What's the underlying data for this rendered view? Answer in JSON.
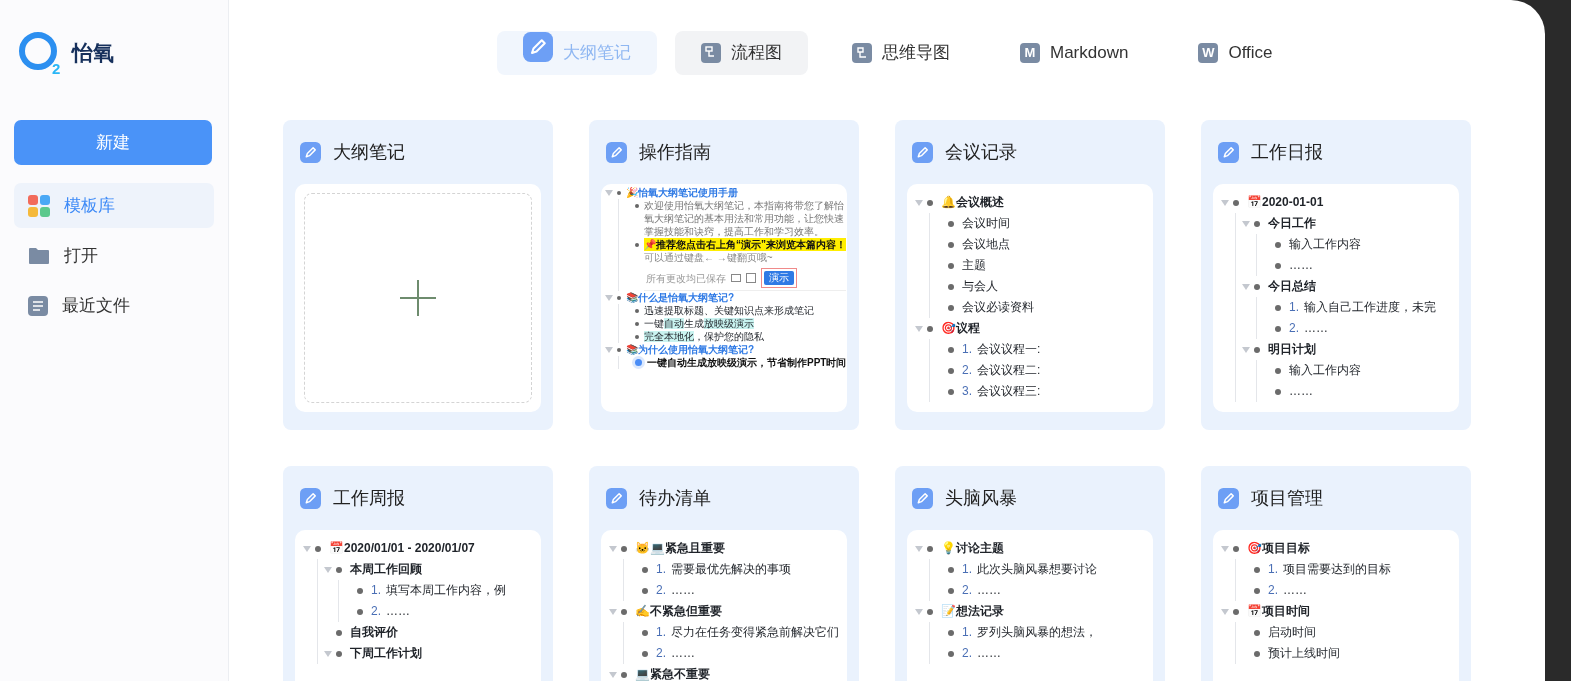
{
  "app": {
    "name": "怡氧",
    "logo_mark": "2"
  },
  "sidebar": {
    "new_button": "新建",
    "items": [
      {
        "label": "模板库",
        "kind": "grid",
        "selected": true
      },
      {
        "label": "打开",
        "kind": "folder",
        "selected": false
      },
      {
        "label": "最近文件",
        "kind": "doc",
        "selected": false
      }
    ]
  },
  "tabs": [
    {
      "label": "大纲笔记",
      "kind": "pen",
      "selected": true,
      "hovered": false
    },
    {
      "label": "流程图",
      "kind": "flow",
      "selected": false,
      "hovered": true
    },
    {
      "label": "思维导图",
      "kind": "mind",
      "selected": false,
      "hovered": false
    },
    {
      "label": "Markdown",
      "kind": "letter",
      "badge": "M",
      "selected": false,
      "hovered": false
    },
    {
      "label": "Office",
      "kind": "letter",
      "badge": "W",
      "selected": false,
      "hovered": false
    }
  ],
  "cards": [
    {
      "title": "大纲笔记",
      "kind": "blank"
    },
    {
      "title": "操作指南",
      "kind": "guide",
      "items": [
        {
          "kind": "heading",
          "text": "🎉怡氧大纲笔记使用手册",
          "expanded": true,
          "children": [
            {
              "kind": "muted",
              "text": "欢迎使用怡氧大纲笔记，本指南将带您了解怡氧大纲笔记的基本用法和常用功能，让您快速掌握技能和诀窍，提高工作和学习效率。"
            },
            {
              "kind": "mark",
              "text": "📌推荐您点击右上角“演示”来浏览本篇内容！",
              "note": "可以通过键盘← →键翻页哦~",
              "toolbar": {
                "status": "所有更改均已保存",
                "button": "演示"
              }
            }
          ]
        },
        {
          "kind": "heading",
          "text": "📚什么是怡氧大纲笔记?",
          "expanded": true,
          "children": [
            {
              "kind": "plain",
              "text": "迅速提取标题、关键知识点来形成笔记"
            },
            {
              "kind": "plain",
              "segments": [
                {
                  "text": "一键",
                  "highlight": false
                },
                {
                  "text": "自动",
                  "highlight": true
                },
                {
                  "text": "生成",
                  "highlight": false
                },
                {
                  "text": "放映级演示",
                  "highlight": true
                }
              ]
            },
            {
              "kind": "plain",
              "segments": [
                {
                  "text": "完全本地化",
                  "highlight": true
                },
                {
                  "text": "，保护您的隐私",
                  "highlight": false
                }
              ]
            }
          ]
        },
        {
          "kind": "heading",
          "text": "📚为什么使用怡氧大纲笔记?",
          "expanded": true,
          "children": [
            {
              "kind": "strong",
              "text": "一键自动生成放映级演示，节省制作PPT时间",
              "active": true
            }
          ]
        }
      ]
    },
    {
      "title": "会议记录",
      "kind": "outline",
      "items": [
        {
          "text": "🔔会议概述",
          "bold": true,
          "expanded": true,
          "children": [
            {
              "text": "会议时间"
            },
            {
              "text": "会议地点"
            },
            {
              "text": "主题"
            },
            {
              "text": "与会人"
            },
            {
              "text": "会议必读资料"
            }
          ]
        },
        {
          "text": "🎯议程",
          "bold": true,
          "expanded": true,
          "children": [
            {
              "num": "1.",
              "text": "会议议程一:"
            },
            {
              "num": "2.",
              "text": "会议议程二:"
            },
            {
              "num": "3.",
              "text": "会议议程三:"
            }
          ]
        }
      ]
    },
    {
      "title": "工作日报",
      "kind": "outline",
      "items": [
        {
          "text": "📅2020-01-01",
          "bold": true,
          "expanded": true,
          "children": [
            {
              "text": "今日工作",
              "bold": true,
              "expanded": true,
              "children": [
                {
                  "text": "输入工作内容"
                },
                {
                  "text": "……"
                }
              ]
            },
            {
              "text": "今日总结",
              "bold": true,
              "expanded": true,
              "children": [
                {
                  "num": "1.",
                  "text": "输入自己工作进度，未完"
                },
                {
                  "num": "2.",
                  "text": "……"
                }
              ]
            },
            {
              "text": "明日计划",
              "bold": true,
              "expanded": true,
              "children": [
                {
                  "text": "输入工作内容"
                },
                {
                  "text": "……"
                }
              ]
            }
          ]
        }
      ]
    },
    {
      "title": "工作周报",
      "kind": "outline",
      "items": [
        {
          "text": "📅2020/01/01 - 2020/01/07",
          "bold": true,
          "expanded": true,
          "children": [
            {
              "text": "本周工作回顾",
              "bold": true,
              "expanded": true,
              "children": [
                {
                  "num": "1.",
                  "text": "填写本周工作内容，例"
                },
                {
                  "num": "2.",
                  "text": "……"
                }
              ]
            },
            {
              "text": "自我评价",
              "bold": true
            },
            {
              "text": "下周工作计划",
              "bold": true,
              "expanded": true
            }
          ]
        }
      ]
    },
    {
      "title": "待办清单",
      "kind": "outline",
      "items": [
        {
          "text": "🐱💻紧急且重要",
          "bold": true,
          "expanded": true,
          "children": [
            {
              "num": "1.",
              "text": "需要最优先解决的事项"
            },
            {
              "num": "2.",
              "text": "……"
            }
          ]
        },
        {
          "text": "✍不紧急但重要",
          "bold": true,
          "expanded": true,
          "children": [
            {
              "num": "1.",
              "text": "尽力在任务变得紧急前解决它们"
            },
            {
              "num": "2.",
              "text": "……"
            }
          ]
        },
        {
          "text": "💻紧急不重要",
          "bold": true,
          "expanded": true
        }
      ]
    },
    {
      "title": "头脑风暴",
      "kind": "outline",
      "items": [
        {
          "text": "💡讨论主题",
          "bold": true,
          "expanded": true,
          "children": [
            {
              "num": "1.",
              "text": "此次头脑风暴想要讨论"
            },
            {
              "num": "2.",
              "text": "……"
            }
          ]
        },
        {
          "text": "📝想法记录",
          "bold": true,
          "expanded": true,
          "children": [
            {
              "num": "1.",
              "text": "罗列头脑风暴的想法，"
            },
            {
              "num": "2.",
              "text": "……"
            }
          ]
        }
      ]
    },
    {
      "title": "项目管理",
      "kind": "outline",
      "items": [
        {
          "text": "🎯项目目标",
          "bold": true,
          "expanded": true,
          "children": [
            {
              "num": "1.",
              "text": "项目需要达到的目标"
            },
            {
              "num": "2.",
              "text": "……"
            }
          ]
        },
        {
          "text": "📅项目时间",
          "bold": true,
          "expanded": true,
          "children": [
            {
              "text": "启动时间"
            },
            {
              "text": "预计上线时间"
            }
          ]
        }
      ]
    }
  ]
}
